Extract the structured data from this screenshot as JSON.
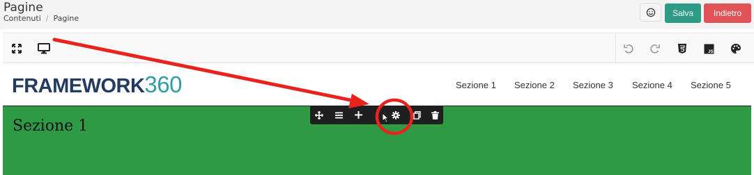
{
  "header": {
    "title": "Pagine",
    "breadcrumb": [
      "Contenuti",
      "Pagine"
    ],
    "emoji_icon": "smile-icon",
    "save_label": "Salva",
    "back_label": "Indietro",
    "colors": {
      "save": "#2e9b86",
      "back": "#e05458"
    }
  },
  "toolbar": {
    "left_icons": [
      "fullscreen-icon",
      "desktop-icon"
    ],
    "right_icons": [
      "undo-icon",
      "redo-icon",
      "html5-icon",
      "js-icon",
      "palette-icon"
    ]
  },
  "site": {
    "logo_word": "FRAMEWORK",
    "logo_number": "360",
    "nav": [
      "Sezione 1",
      "Sezione 2",
      "Sezione 3",
      "Sezione 4",
      "Sezione 5"
    ],
    "section_title": "Sezione 1",
    "section_color": "#2e9a44"
  },
  "block_toolbar": {
    "icons": [
      "move-icon",
      "menu-icon",
      "add-icon",
      "settings-icon",
      "copy-icon",
      "delete-icon"
    ]
  },
  "annotation": {
    "color": "#e8231e"
  }
}
